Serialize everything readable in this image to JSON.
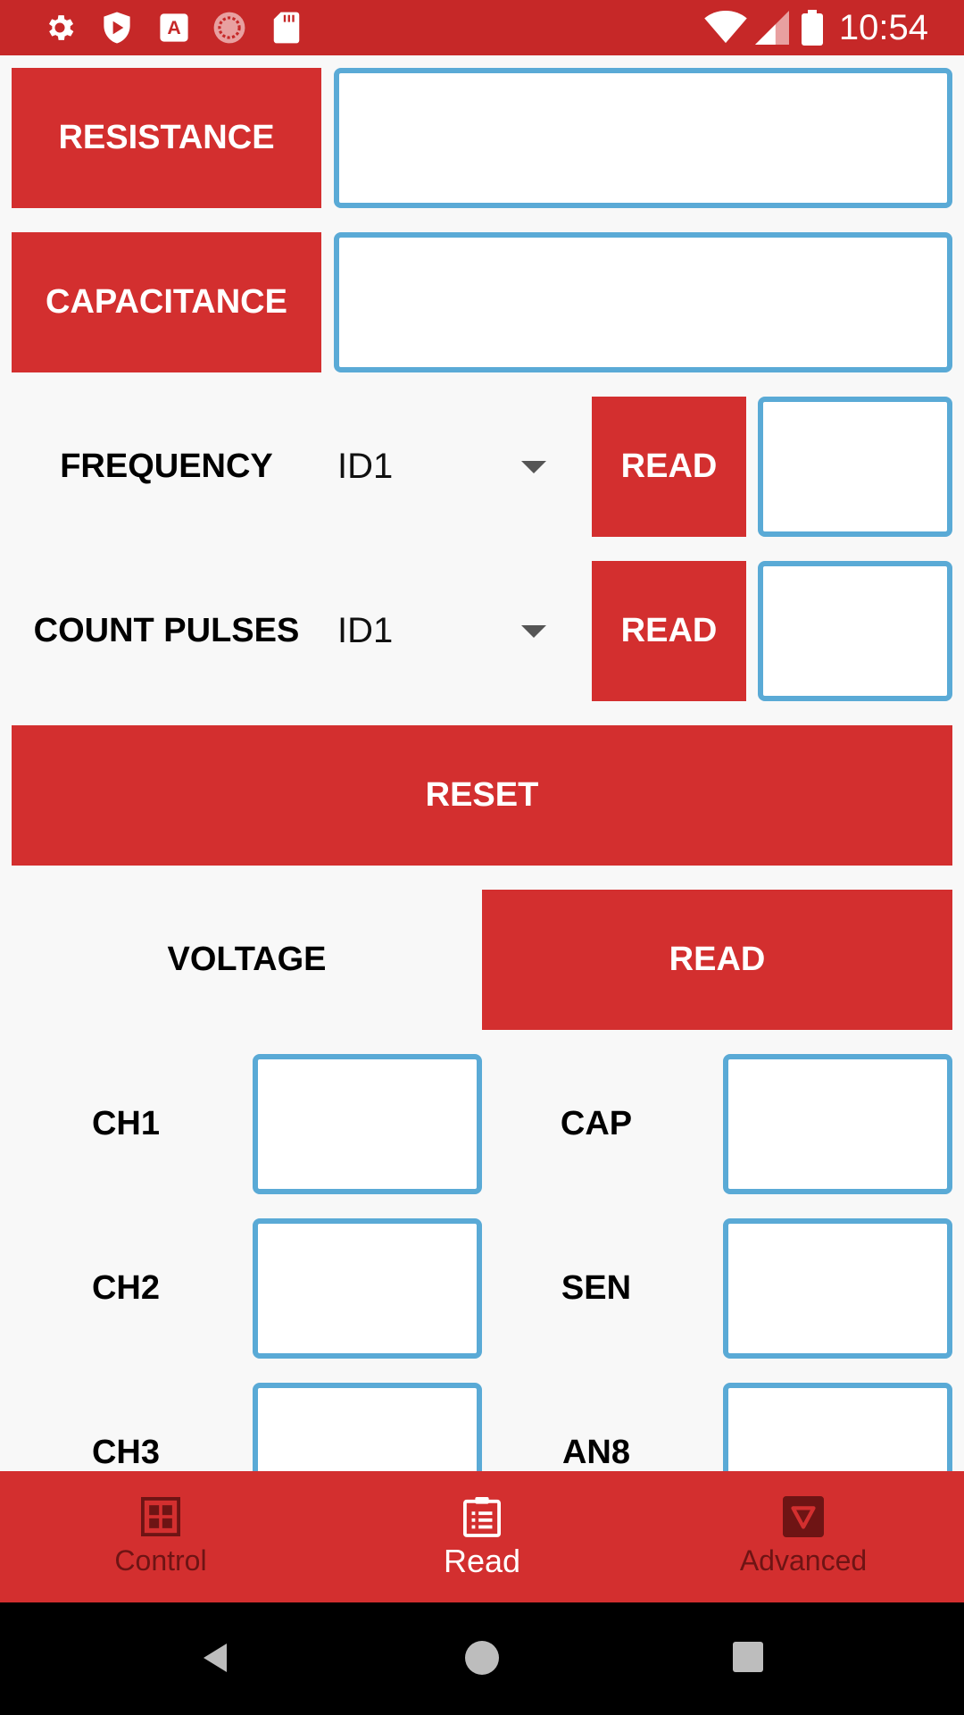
{
  "status_bar": {
    "time": "10:54",
    "icons": [
      "gear-icon",
      "shield-play-icon",
      "a-app-icon",
      "circle-app-icon",
      "sd-card-icon",
      "wifi-icon",
      "signal-icon",
      "battery-icon"
    ]
  },
  "rows": {
    "resistance": {
      "button_label": "RESISTANCE",
      "value": ""
    },
    "capacitance": {
      "button_label": "CAPACITANCE",
      "value": ""
    },
    "frequency": {
      "label": "FREQUENCY",
      "selected": "ID1",
      "read_label": "READ",
      "value": ""
    },
    "count_pulses": {
      "label": "COUNT PULSES",
      "selected": "ID1",
      "read_label": "READ",
      "value": ""
    }
  },
  "reset_label": "RESET",
  "voltage": {
    "label": "VOLTAGE",
    "read_label": "READ",
    "channels_left": [
      {
        "label": "CH1",
        "value": ""
      },
      {
        "label": "CH2",
        "value": ""
      },
      {
        "label": "CH3",
        "value": ""
      }
    ],
    "channels_right": [
      {
        "label": "CAP",
        "value": ""
      },
      {
        "label": "SEN",
        "value": ""
      },
      {
        "label": "AN8",
        "value": ""
      }
    ]
  },
  "bottom_nav": {
    "items": [
      {
        "label": "Control",
        "icon": "grid-icon",
        "active": false
      },
      {
        "label": "Read",
        "icon": "clipboard-list-icon",
        "active": true
      },
      {
        "label": "Advanced",
        "icon": "shield-badge-icon",
        "active": false
      }
    ]
  },
  "colors": {
    "primary": "#d32f2f",
    "status_bar": "#c62828",
    "field_border": "#5aaad6",
    "background": "#f8f8f8"
  }
}
